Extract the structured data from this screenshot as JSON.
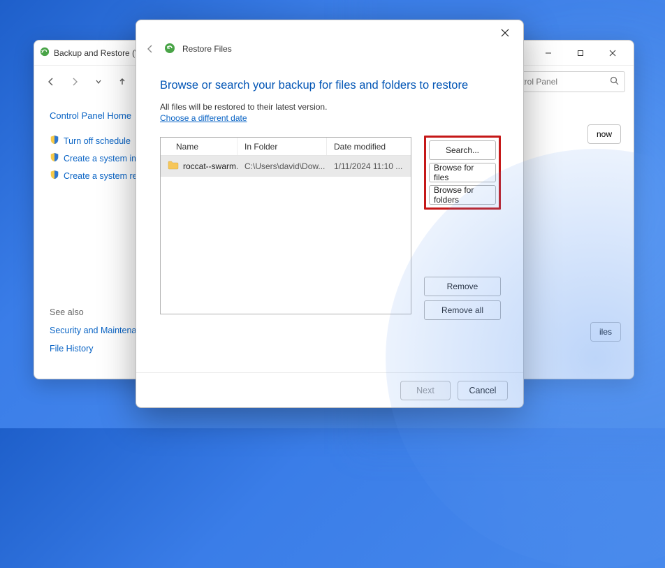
{
  "bg_window": {
    "title": "Backup and Restore (W",
    "search_placeholder": "ontrol Panel",
    "sidebar": {
      "home": "Control Panel Home",
      "links": [
        "Turn off schedule",
        "Create a system image",
        "Create a system repair"
      ],
      "see_also_title": "See also",
      "see_also_links": [
        "Security and Maintenar",
        "File History"
      ]
    },
    "partial_now_btn": "now",
    "partial_iles_btn": "iles"
  },
  "dialog": {
    "head_title": "Restore Files",
    "heading": "Browse or search your backup for files and folders to restore",
    "subtext": "All files will be restored to their latest version.",
    "choose_date_link": "Choose a different date",
    "columns": {
      "name": "Name",
      "folder": "In Folder",
      "date": "Date modified"
    },
    "row": {
      "name": "roccat--swarm...",
      "folder": "C:\\Users\\david\\Dow...",
      "date": "1/11/2024 11:10 ..."
    },
    "actions": {
      "search": "Search...",
      "browse_files": "Browse for files",
      "browse_folders": "Browse for folders",
      "remove": "Remove",
      "remove_all": "Remove all"
    },
    "footer": {
      "next": "Next",
      "cancel": "Cancel"
    }
  }
}
